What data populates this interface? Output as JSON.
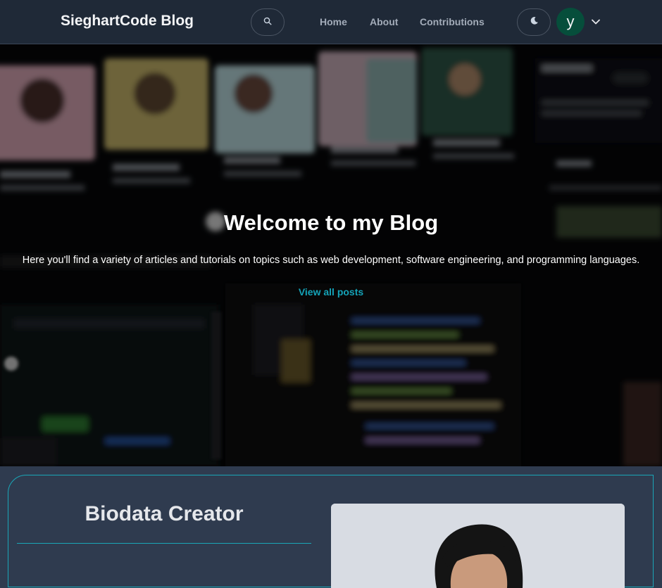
{
  "navbar": {
    "brand": "SieghartCode Blog",
    "links": [
      "Home",
      "About",
      "Contributions"
    ],
    "search_icon": "search-icon",
    "theme_icon": "moon-icon",
    "avatar_letter": "y",
    "avatar_color": "#064e3b",
    "menu_icon": "chevron-down-icon"
  },
  "hero": {
    "title": "Welcome to my Blog",
    "text": "Here you'll find a variety of articles and tutorials on topics such as web development, software engineering, and programming languages.",
    "link": "View all posts",
    "link_color": "#14a3b8"
  },
  "bio": {
    "title": "Biodata Creator",
    "accent_color": "#1aa6b7"
  },
  "colors": {
    "navbar_bg": "#1f2937",
    "page_bg": "#2f3b4f"
  }
}
